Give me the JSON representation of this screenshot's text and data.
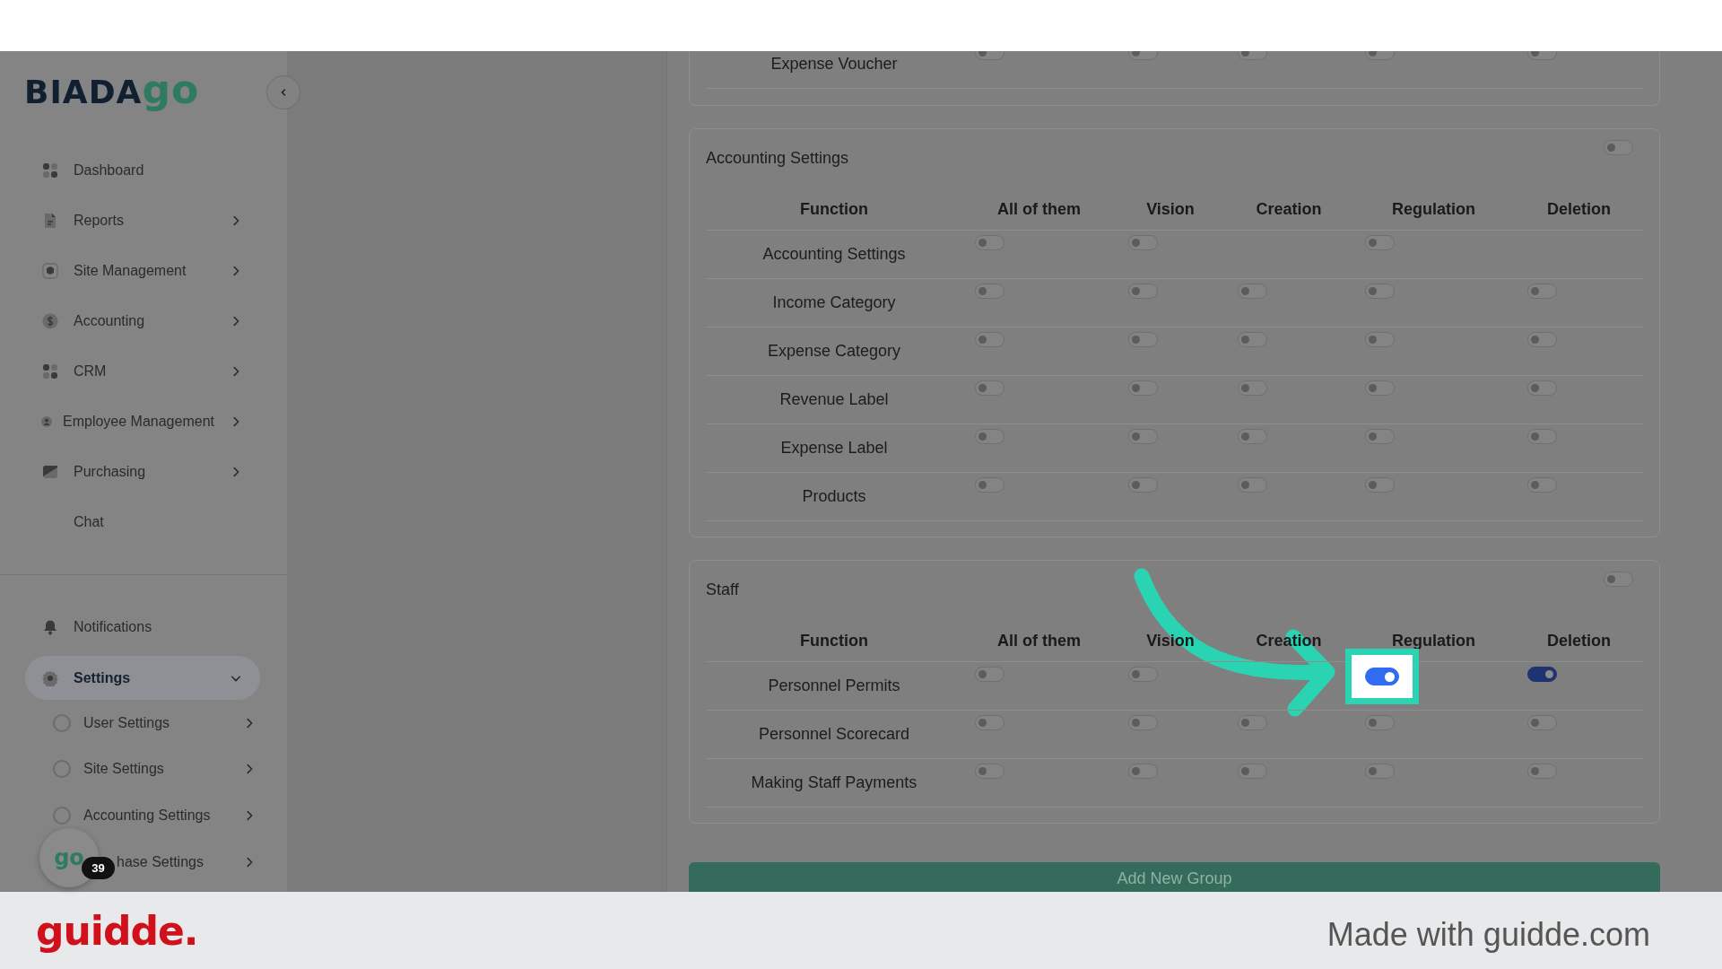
{
  "logo": {
    "text_1": "BIADA",
    "text_2": "go"
  },
  "sidebar": {
    "items": [
      {
        "label": "Dashboard",
        "kind": "grid",
        "has_submenu": false,
        "expanded": false,
        "selected": false
      },
      {
        "label": "Reports",
        "kind": "document",
        "has_submenu": true,
        "expanded": false,
        "selected": false
      },
      {
        "label": "Site Management",
        "kind": "box",
        "has_submenu": true,
        "expanded": false,
        "selected": false
      },
      {
        "label": "Accounting",
        "kind": "dollar",
        "has_submenu": true,
        "expanded": false,
        "selected": false
      },
      {
        "label": "CRM",
        "kind": "grid",
        "has_submenu": true,
        "expanded": false,
        "selected": false
      },
      {
        "label": "Employee Management",
        "kind": "person",
        "has_submenu": true,
        "expanded": false,
        "selected": false
      },
      {
        "label": "Purchasing",
        "kind": "card",
        "has_submenu": true,
        "expanded": false,
        "selected": false
      },
      {
        "label": "Chat",
        "kind": "plain",
        "has_submenu": false,
        "expanded": false,
        "selected": false
      }
    ],
    "bottom_items": [
      {
        "label": "Notifications",
        "kind": "bell",
        "has_submenu": false,
        "expanded": false,
        "selected": false
      },
      {
        "label": "Settings",
        "kind": "gear",
        "has_submenu": true,
        "expanded": true,
        "selected": true,
        "children": [
          {
            "label": "User Settings",
            "kind": "radio",
            "selected": false
          },
          {
            "label": "Site Settings",
            "kind": "radio",
            "selected": false
          },
          {
            "label": "Accounting Settings",
            "kind": "radio",
            "selected": false
          },
          {
            "label": "hase Settings",
            "kind": "covered",
            "selected": false
          }
        ]
      }
    ]
  },
  "chat_bubble": {
    "logo": "go",
    "badge": "39"
  },
  "sections": [
    {
      "rows": [
        {
          "function": "Expense Voucher",
          "cells": [
            {
              "on": false,
              "highlighted": false
            },
            {
              "on": false,
              "highlighted": false
            },
            {
              "on": false,
              "highlighted": false
            },
            {
              "on": false,
              "highlighted": false
            },
            {
              "on": false,
              "highlighted": false
            }
          ]
        }
      ]
    },
    {
      "title": "Accounting Settings",
      "enabled": false,
      "columns": [
        "Function",
        "All of them",
        "Vision",
        "Creation",
        "Regulation",
        "Deletion"
      ],
      "rows": [
        {
          "function": "Accounting Settings",
          "cells": [
            {
              "on": false,
              "highlighted": false
            },
            {
              "on": false,
              "highlighted": false
            },
            null,
            {
              "on": false,
              "highlighted": false
            },
            null
          ]
        },
        {
          "function": "Income Category",
          "cells": [
            {
              "on": false,
              "highlighted": false
            },
            {
              "on": false,
              "highlighted": false
            },
            {
              "on": false,
              "highlighted": false
            },
            {
              "on": false,
              "highlighted": false
            },
            {
              "on": false,
              "highlighted": false
            }
          ]
        },
        {
          "function": "Expense Category",
          "cells": [
            {
              "on": false,
              "highlighted": false
            },
            {
              "on": false,
              "highlighted": false
            },
            {
              "on": false,
              "highlighted": false
            },
            {
              "on": false,
              "highlighted": false
            },
            {
              "on": false,
              "highlighted": false
            }
          ]
        },
        {
          "function": "Revenue Label",
          "cells": [
            {
              "on": false,
              "highlighted": false
            },
            {
              "on": false,
              "highlighted": false
            },
            {
              "on": false,
              "highlighted": false
            },
            {
              "on": false,
              "highlighted": false
            },
            {
              "on": false,
              "highlighted": false
            }
          ]
        },
        {
          "function": "Expense Label",
          "cells": [
            {
              "on": false,
              "highlighted": false
            },
            {
              "on": false,
              "highlighted": false
            },
            {
              "on": false,
              "highlighted": false
            },
            {
              "on": false,
              "highlighted": false
            },
            {
              "on": false,
              "highlighted": false
            }
          ]
        },
        {
          "function": "Products",
          "cells": [
            {
              "on": false,
              "highlighted": false
            },
            {
              "on": false,
              "highlighted": false
            },
            {
              "on": false,
              "highlighted": false
            },
            {
              "on": false,
              "highlighted": false
            },
            {
              "on": false,
              "highlighted": false
            }
          ]
        }
      ]
    },
    {
      "title": "Staff",
      "enabled": false,
      "columns": [
        "Function",
        "All of them",
        "Vision",
        "Creation",
        "Regulation",
        "Deletion"
      ],
      "rows": [
        {
          "function": "Personnel Permits",
          "cells": [
            {
              "on": false,
              "highlighted": false
            },
            {
              "on": false,
              "highlighted": false
            },
            null,
            {
              "on": true,
              "highlighted": true
            },
            {
              "on": true,
              "highlighted": false
            }
          ]
        },
        {
          "function": "Personnel Scorecard",
          "cells": [
            {
              "on": false,
              "highlighted": false
            },
            {
              "on": false,
              "highlighted": false
            },
            {
              "on": false,
              "highlighted": false
            },
            {
              "on": false,
              "highlighted": false
            },
            {
              "on": false,
              "highlighted": false
            }
          ]
        },
        {
          "function": "Making Staff Payments",
          "cells": [
            {
              "on": false,
              "highlighted": false
            },
            {
              "on": false,
              "highlighted": false
            },
            {
              "on": false,
              "highlighted": false
            },
            {
              "on": false,
              "highlighted": false
            },
            {
              "on": false,
              "highlighted": false
            }
          ]
        }
      ]
    }
  ],
  "add_button": "Add New Group",
  "footer": {
    "brand": "guidde.",
    "credit": "Made with guidde.com"
  }
}
